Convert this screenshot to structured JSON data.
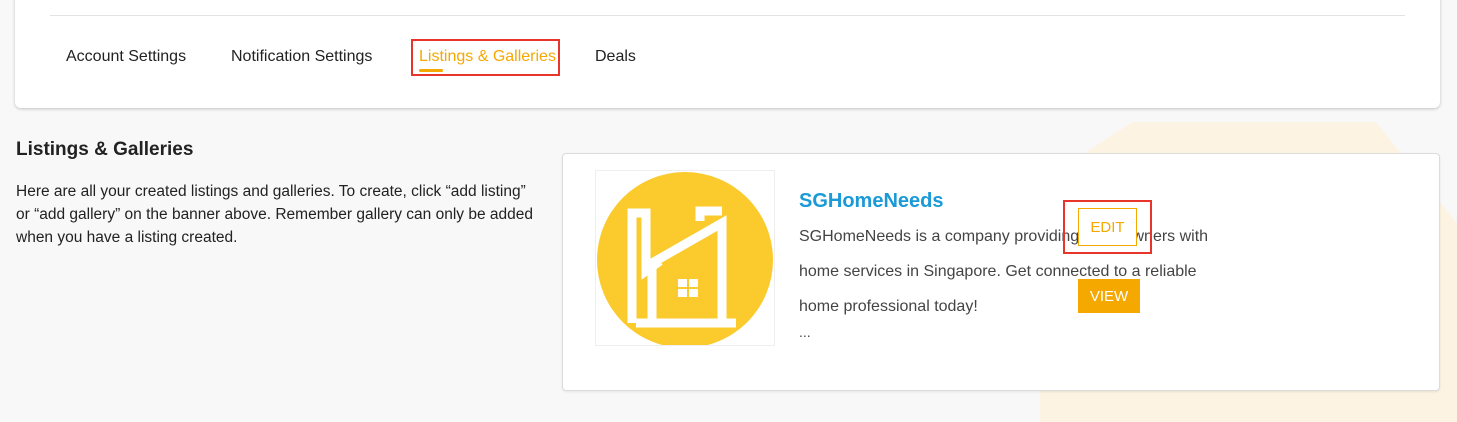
{
  "tabs": [
    {
      "label": "Account Settings"
    },
    {
      "label": "Notification Settings"
    },
    {
      "label": "Listings & Galleries"
    },
    {
      "label": "Deals"
    }
  ],
  "active_tab": "Listings & Galleries",
  "section": {
    "title": "Listings & Galleries",
    "description": "Here are all your created listings and galleries. To create, click “add listing” or “add gallery” on the banner above. Remember gallery can only be added when you have a listing created."
  },
  "listing": {
    "name": "SGHomeNeeds",
    "description": "SGHomeNeeds is a company providing homeowners with home services in Singapore. Get connected to a reliable home professional today!",
    "ellipsis": "...",
    "edit_label": "EDIT",
    "view_label": "VIEW",
    "logo_icon": "house-logo-icon"
  },
  "colors": {
    "accent": "#f5a800",
    "link": "#1a9ad6",
    "highlight": "#e8352b",
    "logo_bg": "#fbcb2e"
  }
}
